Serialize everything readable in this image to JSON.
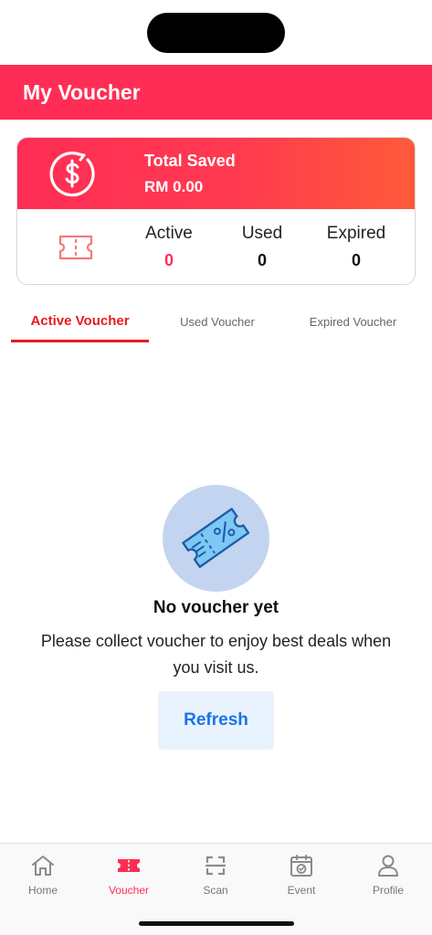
{
  "header": {
    "title": "My Voucher"
  },
  "summary": {
    "saved_label": "Total Saved",
    "saved_value": "RM 0.00",
    "stats": {
      "active": {
        "label": "Active",
        "value": "0"
      },
      "used": {
        "label": "Used",
        "value": "0"
      },
      "expired": {
        "label": "Expired",
        "value": "0"
      }
    },
    "icons": {
      "dollar": "dollar-circle-icon",
      "ticket": "ticket-icon"
    }
  },
  "tabs": [
    {
      "label": "Active Voucher",
      "active": true
    },
    {
      "label": "Used Voucher",
      "active": false
    },
    {
      "label": "Expired Voucher",
      "active": false
    }
  ],
  "empty": {
    "title": "No voucher yet",
    "message": "Please collect voucher to enjoy best deals when you visit us.",
    "refresh_label": "Refresh",
    "icon": "voucher-icon"
  },
  "nav": [
    {
      "label": "Home",
      "icon": "home-icon",
      "active": false
    },
    {
      "label": "Voucher",
      "icon": "voucher-icon",
      "active": true
    },
    {
      "label": "Scan",
      "icon": "scan-icon",
      "active": false
    },
    {
      "label": "Event",
      "icon": "event-icon",
      "active": false
    },
    {
      "label": "Profile",
      "icon": "profile-icon",
      "active": false
    }
  ],
  "colors": {
    "accent": "#ff2d55",
    "tab_active": "#e8191f",
    "refresh_text": "#1a73e8",
    "empty_circle": "#c3d4f0"
  }
}
